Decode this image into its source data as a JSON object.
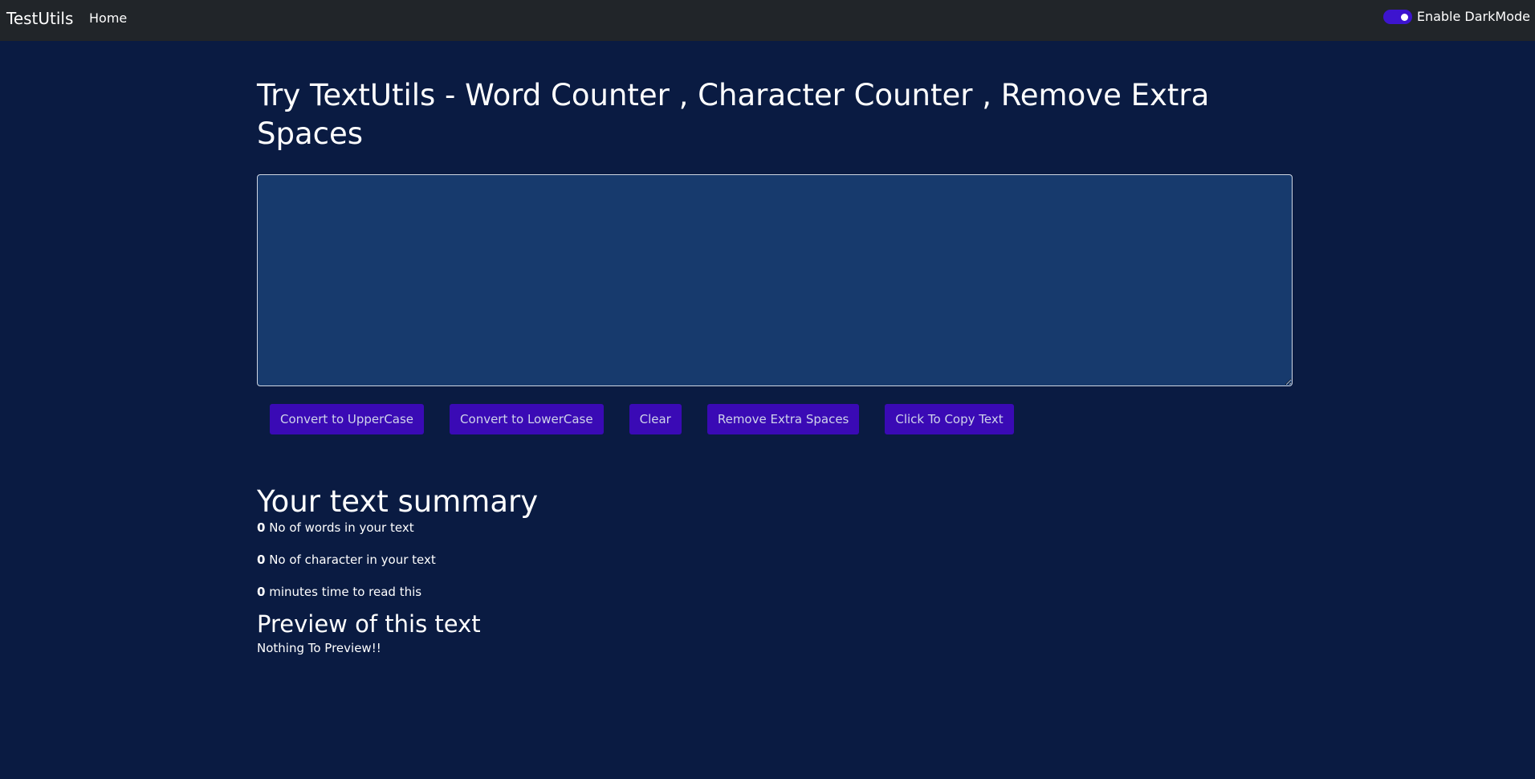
{
  "navbar": {
    "brand": "TestUtils",
    "home_link": "Home",
    "darkmode_label": "Enable DarkMode",
    "darkmode_enabled": true
  },
  "main": {
    "heading": "Try TextUtils - Word Counter , Character Counter , Remove Extra Spaces",
    "textarea_value": "",
    "buttons": {
      "uppercase": "Convert to UpperCase",
      "lowercase": "Convert to LowerCase",
      "clear": "Clear",
      "remove_spaces": "Remove Extra Spaces",
      "copy": "Click To Copy Text"
    }
  },
  "summary": {
    "title": "Your text summary",
    "words_count": "0",
    "words_label": " No of words in your text",
    "chars_count": "0",
    "chars_label": " No of character in your text",
    "minutes_count": "0",
    "minutes_label": " minutes time to read this"
  },
  "preview": {
    "title": "Preview of this text",
    "text": "Nothing To Preview!!"
  },
  "colors": {
    "page_bg": "#0a1b42",
    "navbar_bg": "#212529",
    "textarea_bg": "#173a6d",
    "button_bg": "#3a0ab5",
    "toggle_on": "#3d14cf"
  }
}
